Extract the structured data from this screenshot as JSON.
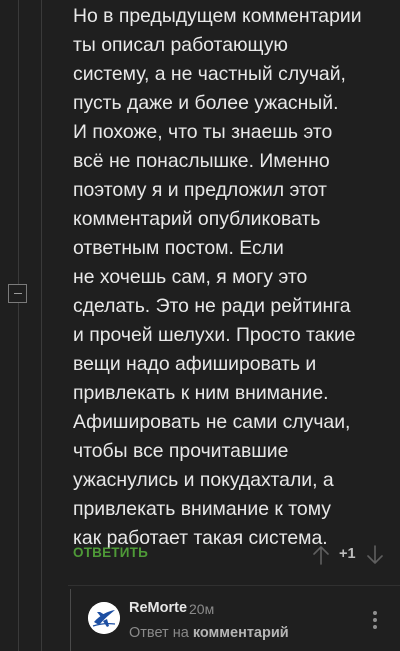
{
  "comment": {
    "lines": [
      "Но в предыдущем комментарии",
      "ты описал работающую",
      "систему, а не частный случай,",
      "пусть даже и более ужасный.",
      "И похоже, что ты знаешь это",
      "всё не понаслышке. Именно",
      "поэтому я и предложил этот",
      "комментарий опубликовать",
      "ответным постом. Если",
      "не хочешь сам, я могу это",
      "сделать. Это не ради рейтинга",
      "и прочей шелухи. Просто такие",
      "вещи надо афишировать и",
      "привлекать к ним внимание.",
      "Афишировать не сами случаи,",
      "чтобы все прочитавшие",
      "ужаснулись и покудахтали, а",
      "привлекать внимание к тому",
      "как работает такая система."
    ],
    "reply_label": "ОТВЕТИТЬ",
    "rating": "+1"
  },
  "reply": {
    "username": "ReMorte",
    "time": "20м",
    "reply_to_prefix": "Ответ на",
    "reply_to_target": "комментарий"
  },
  "icons": {
    "collapse": "collapse-minus-icon",
    "vote_up": "arrow-up-icon",
    "vote_down": "arrow-down-icon",
    "more": "more-vertical-icon",
    "avatar": "airplane-logo-avatar"
  },
  "colors": {
    "background": "#1f1f1f",
    "text": "#e8e8e8",
    "accent_green": "#4e9a37",
    "muted": "#8a8a8a"
  }
}
